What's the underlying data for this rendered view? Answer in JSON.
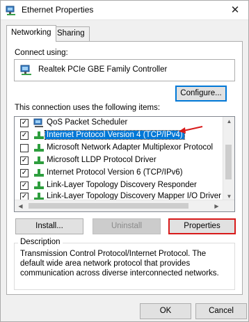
{
  "window": {
    "title": "Ethernet Properties",
    "close_glyph": "✕"
  },
  "tabs": [
    {
      "label": "Networking",
      "active": true
    },
    {
      "label": "Sharing",
      "active": false
    }
  ],
  "connect": {
    "label": "Connect using:",
    "adapter": "Realtek PCIe GBE Family Controller",
    "adapter_icon": "network-adapter-icon",
    "configure_label": "Configure..."
  },
  "items": {
    "label": "This connection uses the following items:",
    "list": [
      {
        "label": "QoS Packet Scheduler",
        "checked": true,
        "icon": "qos-scheduler-icon",
        "selected": false
      },
      {
        "label": "Internet Protocol Version 4 (TCP/IPv4)",
        "checked": true,
        "icon": "protocol-icon",
        "selected": true
      },
      {
        "label": "Microsoft Network Adapter Multiplexor Protocol",
        "checked": false,
        "icon": "protocol-icon",
        "selected": false
      },
      {
        "label": "Microsoft LLDP Protocol Driver",
        "checked": true,
        "icon": "protocol-icon",
        "selected": false
      },
      {
        "label": "Internet Protocol Version 6 (TCP/IPv6)",
        "checked": true,
        "icon": "protocol-icon",
        "selected": false
      },
      {
        "label": "Link-Layer Topology Discovery Responder",
        "checked": true,
        "icon": "protocol-icon",
        "selected": false
      },
      {
        "label": "Link-Layer Topology Discovery Mapper I/O Driver",
        "checked": true,
        "icon": "protocol-icon",
        "selected": false
      }
    ]
  },
  "buttons": {
    "install": "Install...",
    "uninstall": "Uninstall",
    "properties": "Properties",
    "ok": "OK",
    "cancel": "Cancel"
  },
  "description": {
    "title": "Description",
    "text": "Transmission Control Protocol/Internet Protocol. The default wide area network protocol that provides communication across diverse interconnected networks."
  },
  "colors": {
    "selection": "#0078d7",
    "highlight_red": "#d81a1a",
    "protocol_icon_green": "#2e9e3e"
  }
}
